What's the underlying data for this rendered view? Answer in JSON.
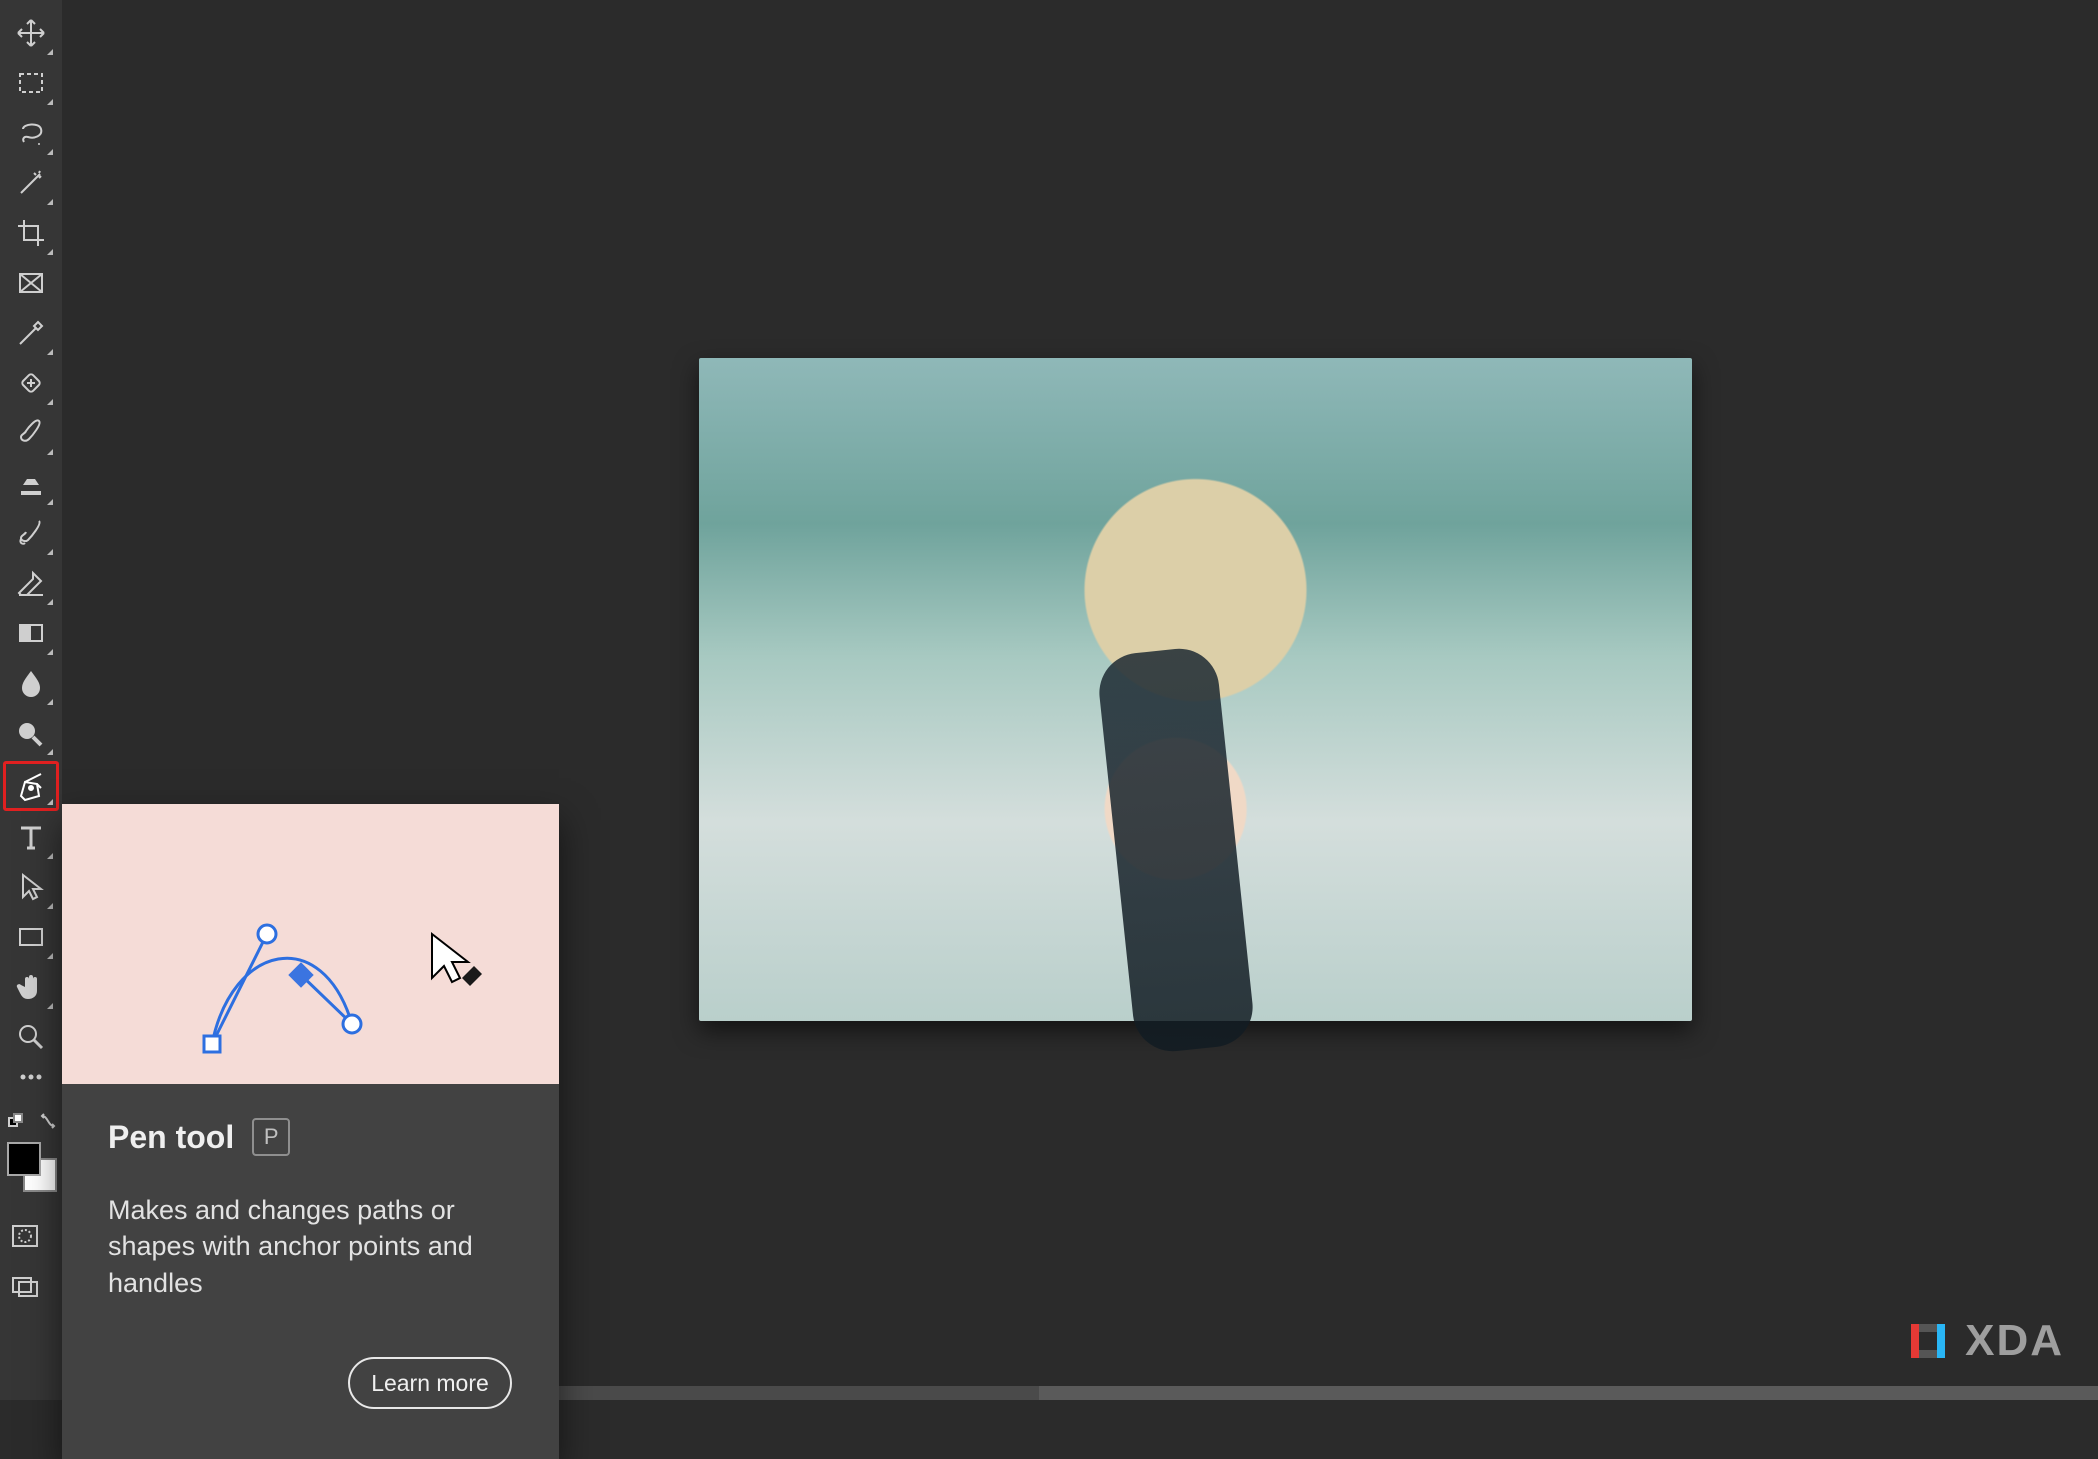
{
  "tools": [
    {
      "id": "move",
      "name": "move-tool-icon",
      "has_flyout": true
    },
    {
      "id": "marquee",
      "name": "marquee-tool-icon",
      "has_flyout": true
    },
    {
      "id": "lasso",
      "name": "lasso-tool-icon",
      "has_flyout": true
    },
    {
      "id": "magic-wand",
      "name": "magic-wand-tool-icon",
      "has_flyout": true
    },
    {
      "id": "crop",
      "name": "crop-tool-icon",
      "has_flyout": true
    },
    {
      "id": "frame",
      "name": "frame-tool-icon",
      "has_flyout": false
    },
    {
      "id": "eyedropper",
      "name": "eyedropper-tool-icon",
      "has_flyout": true
    },
    {
      "id": "healing",
      "name": "healing-brush-tool-icon",
      "has_flyout": true
    },
    {
      "id": "brush",
      "name": "brush-tool-icon",
      "has_flyout": true
    },
    {
      "id": "stamp",
      "name": "clone-stamp-tool-icon",
      "has_flyout": true
    },
    {
      "id": "history-brush",
      "name": "history-brush-tool-icon",
      "has_flyout": true
    },
    {
      "id": "eraser",
      "name": "eraser-tool-icon",
      "has_flyout": true
    },
    {
      "id": "gradient",
      "name": "gradient-tool-icon",
      "has_flyout": true
    },
    {
      "id": "blur",
      "name": "blur-tool-icon",
      "has_flyout": true
    },
    {
      "id": "dodge",
      "name": "dodge-tool-icon",
      "has_flyout": true
    },
    {
      "id": "pen",
      "name": "pen-tool-icon",
      "has_flyout": true,
      "selected": true
    },
    {
      "id": "type",
      "name": "type-tool-icon",
      "has_flyout": true
    },
    {
      "id": "path-select",
      "name": "path-selection-tool-icon",
      "has_flyout": true
    },
    {
      "id": "rectangle",
      "name": "rectangle-tool-icon",
      "has_flyout": true
    },
    {
      "id": "hand",
      "name": "hand-tool-icon",
      "has_flyout": true
    },
    {
      "id": "zoom",
      "name": "zoom-tool-icon",
      "has_flyout": false
    }
  ],
  "extra_tools_label": "…",
  "colors": {
    "foreground": "#000000",
    "background": "#ffffff"
  },
  "tooltip": {
    "title": "Pen tool",
    "shortcut": "P",
    "description": "Makes and changes paths or shapes with anchor points and handles",
    "learn_more_label": "Learn more"
  },
  "watermark": {
    "brand": "XDA"
  }
}
